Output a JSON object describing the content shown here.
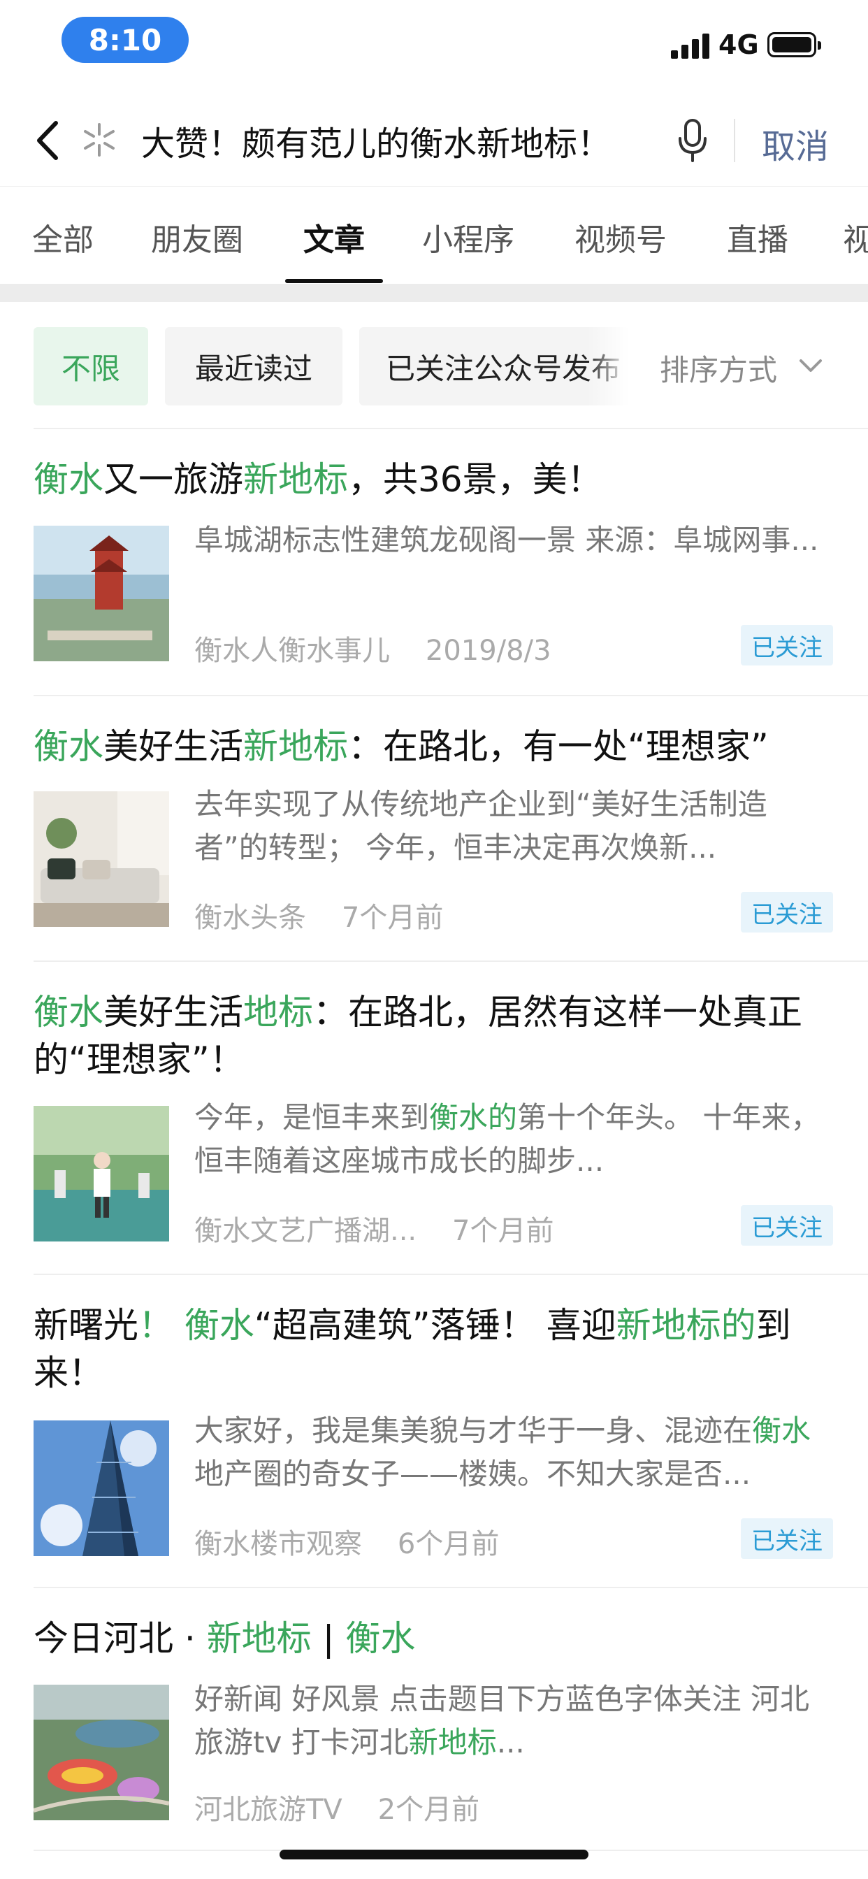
{
  "status_bar": {
    "time": "8:10",
    "network": "4G"
  },
  "search": {
    "query": "大赞！颇有范儿的衡水新地标！",
    "cancel_label": "取消"
  },
  "tabs": [
    {
      "label": "全部"
    },
    {
      "label": "朋友圈"
    },
    {
      "label": "文章"
    },
    {
      "label": "小程序"
    },
    {
      "label": "视频号"
    },
    {
      "label": "直播"
    },
    {
      "label": "视"
    }
  ],
  "filters": {
    "chips": [
      {
        "label": "不限"
      },
      {
        "label": "最近读过"
      },
      {
        "label": "已关注公众号发布"
      }
    ],
    "sort_label": "排序方式"
  },
  "articles": [
    {
      "title_parts": [
        {
          "text": "衡水",
          "hl": true
        },
        {
          "text": "又一旅游",
          "hl": false
        },
        {
          "text": "新地标",
          "hl": true
        },
        {
          "text": "，共36景，美！",
          "hl": false
        }
      ],
      "summary_parts": [
        {
          "text": "阜城湖标志性建筑龙砚阁一景 来源：阜城网事...",
          "hl": false
        }
      ],
      "source": "衡水人衡水事儿",
      "time": "2019/8/3",
      "badge": "已关注"
    },
    {
      "title_parts": [
        {
          "text": "衡水",
          "hl": true
        },
        {
          "text": "美好生活",
          "hl": false
        },
        {
          "text": "新地标",
          "hl": true
        },
        {
          "text": "：在路北，有一处“理想家”",
          "hl": false
        }
      ],
      "summary_parts": [
        {
          "text": "去年实现了从传统地产企业到“美好生活制造者”的转型； 今年，恒丰决定再次焕新...",
          "hl": false
        }
      ],
      "source": "衡水头条",
      "time": "7个月前",
      "badge": "已关注"
    },
    {
      "title_parts": [
        {
          "text": "衡水",
          "hl": true
        },
        {
          "text": "美好生活",
          "hl": false
        },
        {
          "text": "地标",
          "hl": true
        },
        {
          "text": "：在路北，居然有这样一处真正的“理想家”！",
          "hl": false
        }
      ],
      "summary_parts": [
        {
          "text": "今年，是恒丰来到",
          "hl": false
        },
        {
          "text": "衡水的",
          "hl": true
        },
        {
          "text": "第十个年头。 十年来，恒丰随着这座城市成长的脚步...",
          "hl": false
        }
      ],
      "source": "衡水文艺广播湖...",
      "time": "7个月前",
      "badge": "已关注"
    },
    {
      "title_parts": [
        {
          "text": "新曙光",
          "hl": false
        },
        {
          "text": "！ 衡水",
          "hl": true
        },
        {
          "text": "“超高建筑”落锤！ 喜迎",
          "hl": false
        },
        {
          "text": "新地标的",
          "hl": true
        },
        {
          "text": "到来！",
          "hl": false
        }
      ],
      "summary_parts": [
        {
          "text": "大家好，我是集美貌与才华于一身、混迹在",
          "hl": false
        },
        {
          "text": "衡水",
          "hl": true
        },
        {
          "text": "地产圈的奇女子——楼姨。不知大家是否...",
          "hl": false
        }
      ],
      "source": "衡水楼市观察",
      "time": "6个月前",
      "badge": "已关注"
    },
    {
      "title_parts": [
        {
          "text": "今日河北 · ",
          "hl": false
        },
        {
          "text": "新地标",
          "hl": true
        },
        {
          "text": " | ",
          "hl": false
        },
        {
          "text": "衡水",
          "hl": true
        }
      ],
      "summary_parts": [
        {
          "text": "好新闻 好风景 点击题目下方蓝色字体关注 河北旅游tv 打卡河北",
          "hl": false
        },
        {
          "text": "新地标",
          "hl": true
        },
        {
          "text": "...",
          "hl": false
        }
      ],
      "source": "河北旅游TV",
      "time": "2个月前",
      "badge": ""
    }
  ],
  "colors": {
    "highlight": "#3aa65b",
    "badge_text": "#2a9bd4",
    "time_pill": "#2f80ed",
    "cancel": "#576b95"
  }
}
